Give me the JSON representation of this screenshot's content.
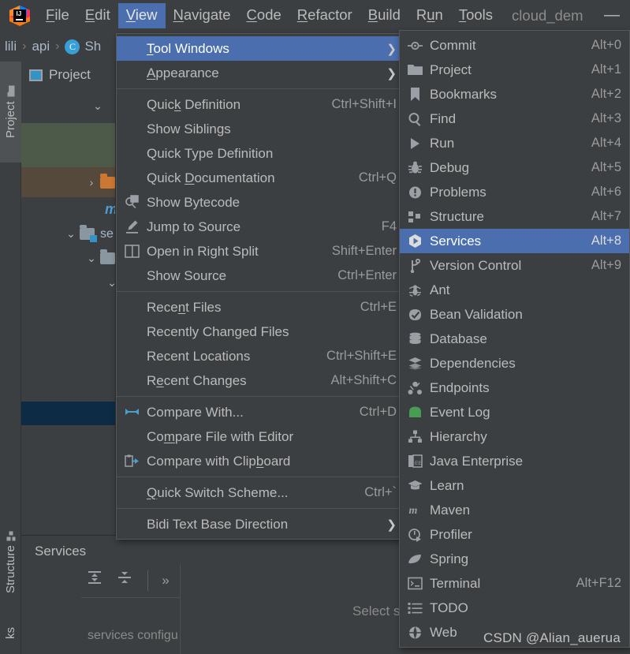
{
  "window": {
    "project_name": "cloud_dem",
    "minimize_label": "—",
    "logo_icon": "intellij-idea-logo"
  },
  "menubar": {
    "items": [
      {
        "label": "File",
        "mnemonic": "F",
        "active": false
      },
      {
        "label": "Edit",
        "mnemonic": "E",
        "active": false
      },
      {
        "label": "View",
        "mnemonic": "V",
        "active": true
      },
      {
        "label": "Navigate",
        "mnemonic": "N",
        "active": false
      },
      {
        "label": "Code",
        "mnemonic": "C",
        "active": false
      },
      {
        "label": "Refactor",
        "mnemonic": "R",
        "active": false
      },
      {
        "label": "Build",
        "mnemonic": "B",
        "active": false
      },
      {
        "label": "Run",
        "mnemonic": "u",
        "active": false
      },
      {
        "label": "Tools",
        "mnemonic": "T",
        "active": false
      }
    ]
  },
  "breadcrumb": {
    "items": [
      "lili",
      "api",
      "Sh"
    ],
    "separator": "›",
    "class_badge": "C"
  },
  "left_strip": {
    "project_tab": "Project",
    "structure_tab": "Structure",
    "bookmarks_tab": "ks"
  },
  "project_panel": {
    "title": "Project",
    "rows": [
      {
        "label": "",
        "kind": "blank-green",
        "chevron": ""
      },
      {
        "label": "",
        "kind": "folder-orange",
        "chevron": "›"
      },
      {
        "label": "m",
        "kind": "maven",
        "chevron": ""
      },
      {
        "label": "se",
        "kind": "folder-source",
        "chevron": "⌄"
      },
      {
        "label": "",
        "kind": "folder",
        "chevron": "⌄"
      },
      {
        "label": "",
        "kind": "none",
        "chevron": "⌄"
      }
    ]
  },
  "services_panel": {
    "title": "Services",
    "expand_all_icon": "expand-all-icon",
    "collapse_all_icon": "collapse-all-icon",
    "more_icon": "»",
    "tree_hint": "services configu",
    "empty_text": "Select s"
  },
  "view_menu": {
    "groups": [
      [
        {
          "label": "Tool Windows",
          "mnemonic": "T",
          "accel": "",
          "submenu": true,
          "selected": true,
          "icon": ""
        },
        {
          "label": "Appearance",
          "mnemonic": "A",
          "accel": "",
          "submenu": true,
          "selected": false,
          "icon": ""
        }
      ],
      [
        {
          "label": "Quick Definition",
          "mnemonic": "k",
          "accel": "Ctrl+Shift+I",
          "submenu": false,
          "selected": false,
          "icon": ""
        },
        {
          "label": "Show Siblings",
          "mnemonic": "",
          "accel": "",
          "submenu": false,
          "selected": false,
          "icon": ""
        },
        {
          "label": "Quick Type Definition",
          "mnemonic": "",
          "accel": "",
          "submenu": false,
          "selected": false,
          "icon": ""
        },
        {
          "label": "Quick Documentation",
          "mnemonic": "D",
          "accel": "Ctrl+Q",
          "submenu": false,
          "selected": false,
          "icon": ""
        },
        {
          "label": "Show Bytecode",
          "mnemonic": "",
          "accel": "",
          "submenu": false,
          "selected": false,
          "icon": "bytecode-icon"
        },
        {
          "label": "Jump to Source",
          "mnemonic": "",
          "accel": "F4",
          "submenu": false,
          "selected": false,
          "icon": "pencil-icon"
        },
        {
          "label": "Open in Right Split",
          "mnemonic": "",
          "accel": "Shift+Enter",
          "submenu": false,
          "selected": false,
          "icon": "split-icon"
        },
        {
          "label": "Show Source",
          "mnemonic": "",
          "accel": "Ctrl+Enter",
          "submenu": false,
          "selected": false,
          "icon": ""
        }
      ],
      [
        {
          "label": "Recent Files",
          "mnemonic": "n",
          "accel": "Ctrl+E",
          "submenu": false,
          "selected": false,
          "icon": ""
        },
        {
          "label": "Recently Changed Files",
          "mnemonic": "",
          "accel": "",
          "submenu": false,
          "selected": false,
          "icon": ""
        },
        {
          "label": "Recent Locations",
          "mnemonic": "",
          "accel": "Ctrl+Shift+E",
          "submenu": false,
          "selected": false,
          "icon": ""
        },
        {
          "label": "Recent Changes",
          "mnemonic": "e",
          "accel": "Alt+Shift+C",
          "submenu": false,
          "selected": false,
          "icon": ""
        }
      ],
      [
        {
          "label": "Compare With...",
          "mnemonic": "",
          "accel": "Ctrl+D",
          "submenu": false,
          "selected": false,
          "icon": "compare-icon"
        },
        {
          "label": "Compare File with Editor",
          "mnemonic": "m",
          "accel": "",
          "submenu": false,
          "selected": false,
          "icon": ""
        },
        {
          "label": "Compare with Clipboard",
          "mnemonic": "b",
          "accel": "",
          "submenu": false,
          "selected": false,
          "icon": "clipboard-compare-icon"
        }
      ],
      [
        {
          "label": "Quick Switch Scheme...",
          "mnemonic": "Q",
          "accel": "Ctrl+`",
          "submenu": false,
          "selected": false,
          "icon": ""
        }
      ],
      [
        {
          "label": "Bidi Text Base Direction",
          "mnemonic": "",
          "accel": "",
          "submenu": true,
          "selected": false,
          "icon": ""
        }
      ]
    ]
  },
  "tool_windows_menu": {
    "items": [
      {
        "label": "Commit",
        "accel": "Alt+0",
        "icon": "commit-icon",
        "selected": false
      },
      {
        "label": "Project",
        "accel": "Alt+1",
        "icon": "folder-icon",
        "selected": false
      },
      {
        "label": "Bookmarks",
        "accel": "Alt+2",
        "icon": "bookmark-icon",
        "selected": false
      },
      {
        "label": "Find",
        "accel": "Alt+3",
        "icon": "search-icon",
        "selected": false
      },
      {
        "label": "Run",
        "accel": "Alt+4",
        "icon": "play-icon",
        "selected": false
      },
      {
        "label": "Debug",
        "accel": "Alt+5",
        "icon": "bug-icon",
        "selected": false
      },
      {
        "label": "Problems",
        "accel": "Alt+6",
        "icon": "warning-icon",
        "selected": false
      },
      {
        "label": "Structure",
        "accel": "Alt+7",
        "icon": "structure-icon",
        "selected": false
      },
      {
        "label": "Services",
        "accel": "Alt+8",
        "icon": "services-icon",
        "selected": true
      },
      {
        "label": "Version Control",
        "accel": "Alt+9",
        "icon": "branch-icon",
        "selected": false
      },
      {
        "label": "Ant",
        "accel": "",
        "icon": "ant-icon",
        "selected": false
      },
      {
        "label": "Bean Validation",
        "accel": "",
        "icon": "bean-validation-icon",
        "selected": false
      },
      {
        "label": "Database",
        "accel": "",
        "icon": "database-icon",
        "selected": false
      },
      {
        "label": "Dependencies",
        "accel": "",
        "icon": "layers-icon",
        "selected": false
      },
      {
        "label": "Endpoints",
        "accel": "",
        "icon": "endpoints-icon",
        "selected": false
      },
      {
        "label": "Event Log",
        "accel": "",
        "icon": "event-log-icon",
        "selected": false
      },
      {
        "label": "Hierarchy",
        "accel": "",
        "icon": "hierarchy-icon",
        "selected": false
      },
      {
        "label": "Java Enterprise",
        "accel": "",
        "icon": "java-enterprise-icon",
        "selected": false
      },
      {
        "label": "Learn",
        "accel": "",
        "icon": "graduation-cap-icon",
        "selected": false
      },
      {
        "label": "Maven",
        "accel": "",
        "icon": "maven-icon",
        "selected": false
      },
      {
        "label": "Profiler",
        "accel": "",
        "icon": "profiler-icon",
        "selected": false
      },
      {
        "label": "Spring",
        "accel": "",
        "icon": "spring-leaf-icon",
        "selected": false
      },
      {
        "label": "Terminal",
        "accel": "Alt+F12",
        "icon": "terminal-icon",
        "selected": false
      },
      {
        "label": "TODO",
        "accel": "",
        "icon": "todo-list-icon",
        "selected": false
      },
      {
        "label": "Web",
        "accel": "",
        "icon": "globe-icon",
        "selected": false
      }
    ]
  },
  "watermark": {
    "text": "CSDN @Alian_auerua"
  },
  "colors": {
    "accent_selection": "#4b6eaf",
    "menu_background": "#3c3f41",
    "text": "#bbbbbb",
    "accel_text": "#9a9a9a",
    "icon_gray": "#9aa0a6",
    "icon_blue": "#4d9ecf",
    "event_log_green": "#499c54"
  }
}
